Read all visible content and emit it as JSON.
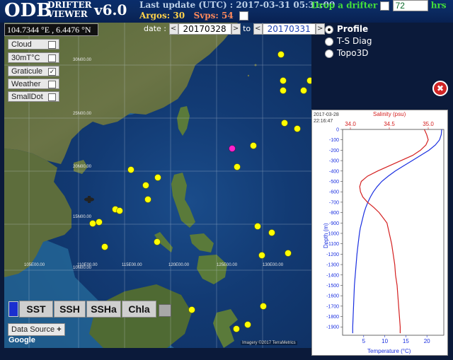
{
  "header": {
    "logo": "ODB",
    "logo_sub1": "DRIFTER",
    "logo_sub2": "VIEWER",
    "version": "v6.0",
    "last_update_label": "Last update (UTC) : 2017-03-31 05:31:00",
    "argos_label": "Argos: 30",
    "svps_label": "Svps: 54",
    "drop_label": "Drop a drifter",
    "drop_value": "72",
    "drop_unit": "hrs"
  },
  "map": {
    "coord_readout": "104.7344 °E , 6.4476 °N",
    "date_label": "date :",
    "date_from": "20170328",
    "to_label": "to",
    "date_to": "20170331",
    "lat_labels": [
      "30N00.00",
      "25N00.00",
      "20N00.00",
      "15N00.00",
      "10N00.00"
    ],
    "lon_labels": [
      "105E00.00",
      "110E00.00",
      "115E00.00",
      "120E00.00",
      "125E00.00",
      "130E00.00"
    ],
    "layers": [
      {
        "label": "Cloud",
        "checked": false
      },
      {
        "label": "30mT°C",
        "checked": false
      },
      {
        "label": "Graticule",
        "checked": true
      },
      {
        "label": "Weather",
        "checked": false
      },
      {
        "label": "SmallDot",
        "checked": false
      }
    ],
    "data_source_label": "Data Source",
    "google_label": "Google",
    "imagery_label": "Imagery ©2017 TerraMetrics",
    "tabs": [
      "SST",
      "SSH",
      "SSHa",
      "Chla"
    ]
  },
  "modes": [
    {
      "label": "Profile",
      "selected": true
    },
    {
      "label": "T-S Diag",
      "selected": false
    },
    {
      "label": "Topo3D",
      "selected": false
    }
  ],
  "plot": {
    "date": "2017-03-28",
    "time": "22:16:47",
    "salinity_label": "Salinity (psu)",
    "temperature_label": "Temperature (°C)",
    "depth_label": "Depth (m)",
    "sal_ticks": [
      "34.0",
      "34.5",
      "35.0"
    ],
    "temp_ticks": [
      "5",
      "10",
      "15",
      "20"
    ],
    "depth_ticks": [
      "0",
      "-100",
      "-200",
      "-300",
      "-400",
      "-500",
      "-600",
      "-700",
      "-800",
      "-900",
      "-1000",
      "-1100",
      "-1200",
      "-1300",
      "-1400",
      "-1500",
      "-1600",
      "-1700",
      "-1800",
      "-1900"
    ],
    "colors": {
      "salinity": "#d42020",
      "temperature": "#1a2fe0"
    }
  },
  "chart_data": {
    "type": "line",
    "title": "",
    "xlabel": "Temperature (°C)",
    "ylabel": "Depth (m)",
    "ylim": [
      -1980,
      0
    ],
    "series": [
      {
        "name": "Temperature (°C)",
        "axis": "bottom",
        "xlim": [
          0,
          24
        ],
        "points": [
          [
            23.5,
            0
          ],
          [
            23.4,
            -50
          ],
          [
            23.0,
            -100
          ],
          [
            22.0,
            -150
          ],
          [
            20.5,
            -200
          ],
          [
            18.5,
            -250
          ],
          [
            16.5,
            -300
          ],
          [
            14.5,
            -350
          ],
          [
            12.5,
            -400
          ],
          [
            10.8,
            -450
          ],
          [
            9.3,
            -500
          ],
          [
            8.2,
            -550
          ],
          [
            7.3,
            -600
          ],
          [
            6.6,
            -650
          ],
          [
            6.0,
            -700
          ],
          [
            5.5,
            -750
          ],
          [
            5.1,
            -800
          ],
          [
            4.8,
            -850
          ],
          [
            4.5,
            -900
          ],
          [
            4.2,
            -950
          ],
          [
            4.0,
            -1000
          ],
          [
            3.7,
            -1100
          ],
          [
            3.4,
            -1200
          ],
          [
            3.2,
            -1300
          ],
          [
            3.0,
            -1400
          ],
          [
            2.8,
            -1500
          ],
          [
            2.7,
            -1600
          ],
          [
            2.6,
            -1700
          ],
          [
            2.5,
            -1800
          ],
          [
            2.4,
            -1900
          ],
          [
            2.4,
            -1960
          ]
        ]
      },
      {
        "name": "Salinity (psu)",
        "axis": "top",
        "xlim": [
          33.9,
          35.2
        ],
        "points": [
          [
            34.95,
            0
          ],
          [
            34.98,
            -50
          ],
          [
            35.0,
            -100
          ],
          [
            34.97,
            -150
          ],
          [
            34.9,
            -200
          ],
          [
            34.8,
            -250
          ],
          [
            34.65,
            -300
          ],
          [
            34.5,
            -350
          ],
          [
            34.35,
            -400
          ],
          [
            34.22,
            -450
          ],
          [
            34.14,
            -500
          ],
          [
            34.12,
            -550
          ],
          [
            34.13,
            -600
          ],
          [
            34.16,
            -650
          ],
          [
            34.22,
            -700
          ],
          [
            34.3,
            -750
          ],
          [
            34.37,
            -800
          ],
          [
            34.42,
            -850
          ],
          [
            34.47,
            -900
          ],
          [
            34.5,
            -1000
          ],
          [
            34.53,
            -1100
          ],
          [
            34.55,
            -1200
          ],
          [
            34.57,
            -1300
          ],
          [
            34.58,
            -1400
          ],
          [
            34.6,
            -1500
          ],
          [
            34.61,
            -1600
          ],
          [
            34.62,
            -1700
          ],
          [
            34.63,
            -1800
          ],
          [
            34.64,
            -1900
          ],
          [
            34.64,
            -1960
          ]
        ]
      }
    ]
  }
}
